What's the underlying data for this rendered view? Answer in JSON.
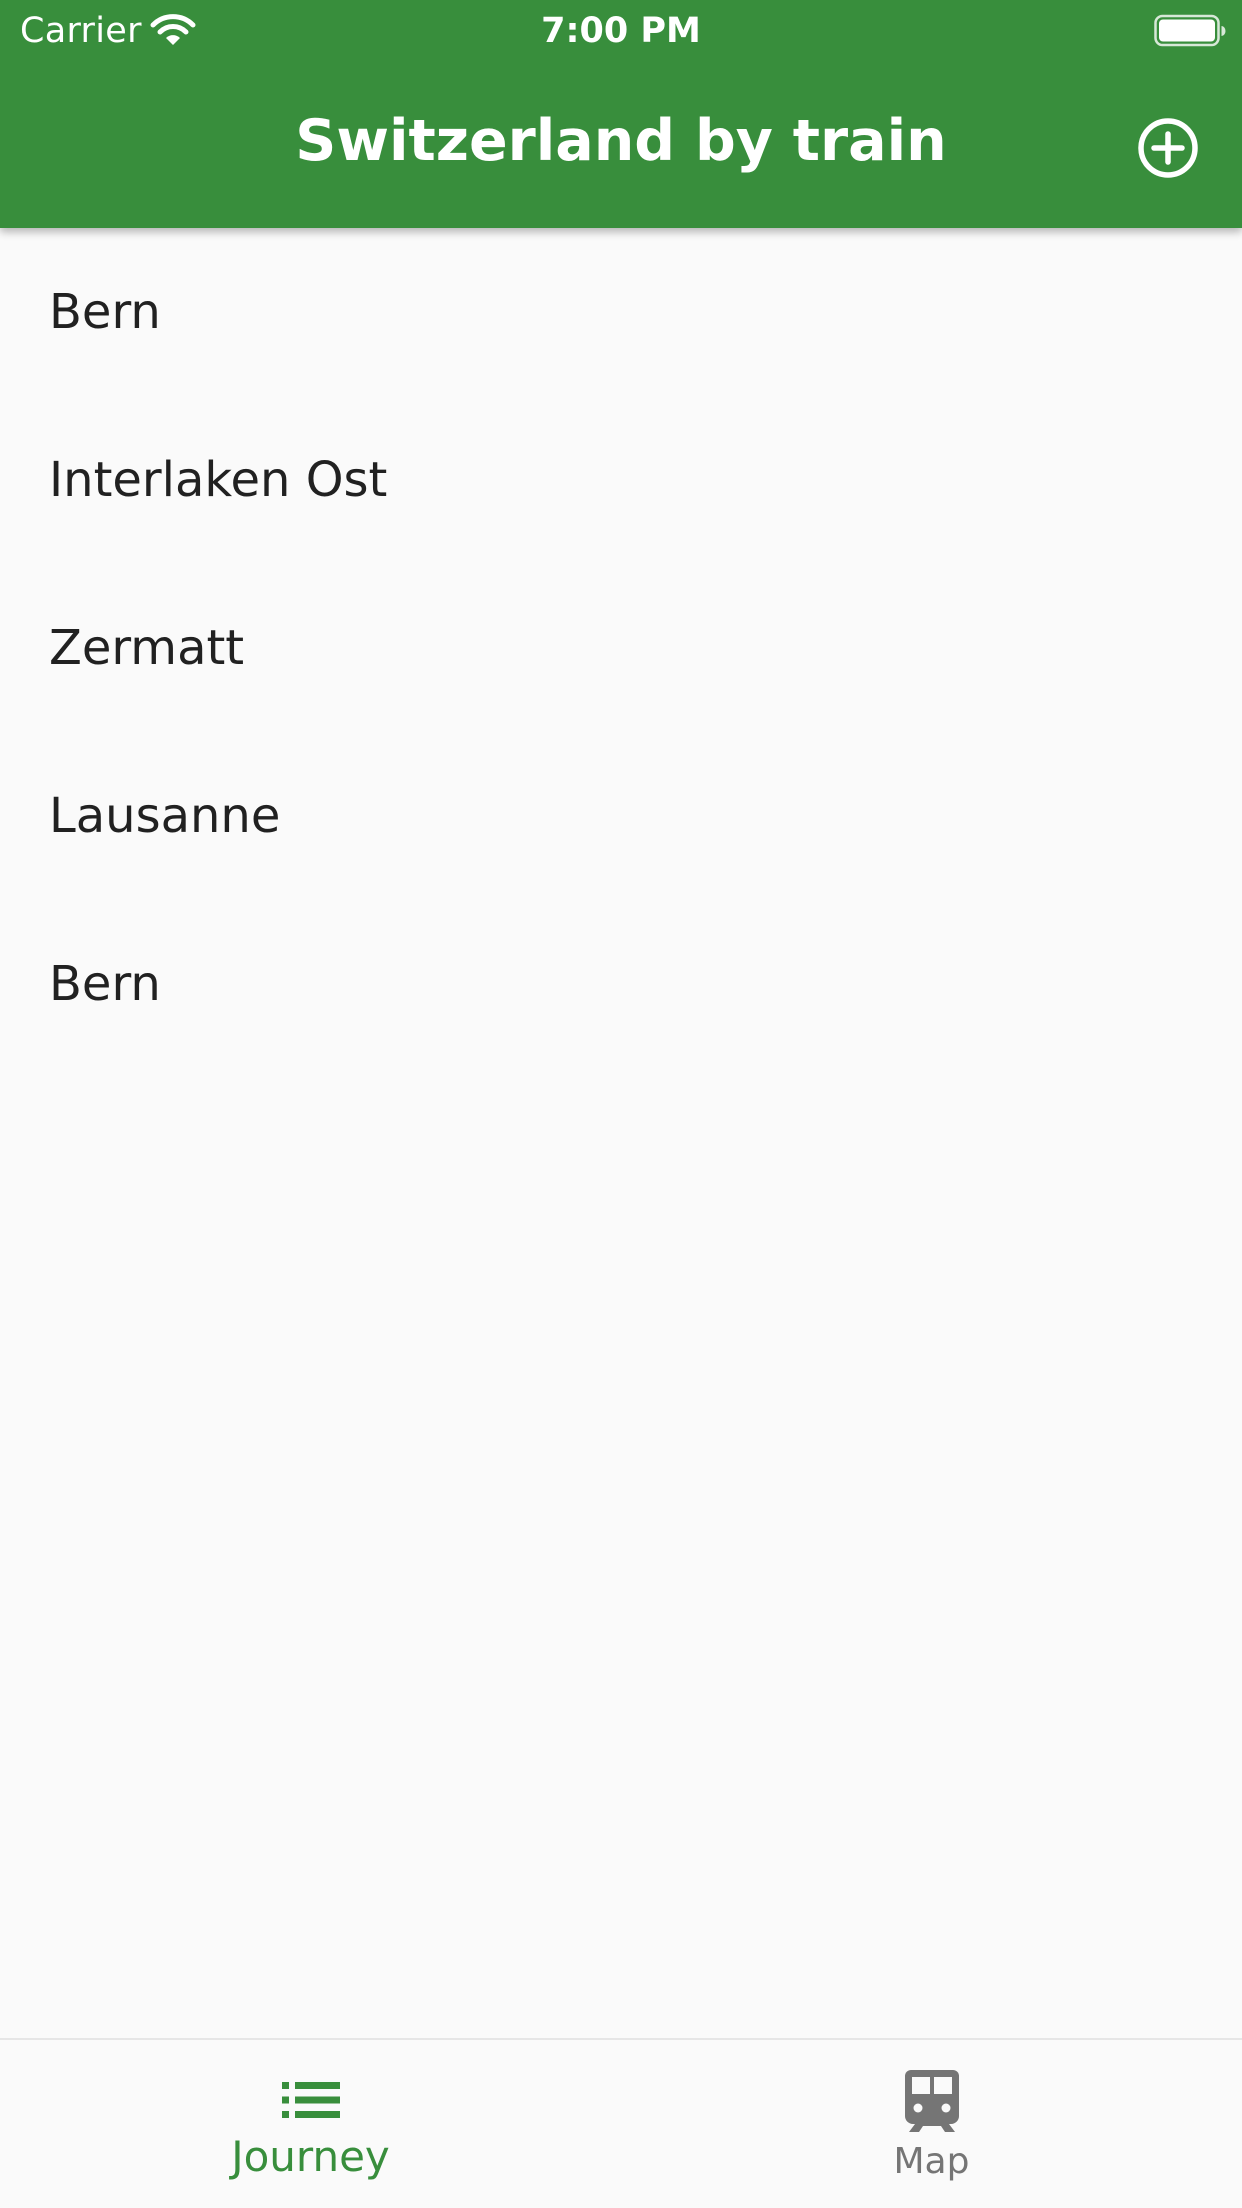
{
  "status_bar": {
    "carrier": "Carrier",
    "time": "7:00 PM",
    "wifi_icon": "wifi-icon",
    "battery_icon": "battery-icon"
  },
  "app_bar": {
    "title": "Switzerland by train",
    "action_icon": "add-circle-icon",
    "background_color": "#388e3c"
  },
  "journey": {
    "stops": [
      "Bern",
      "Interlaken Ost",
      "Zermatt",
      "Lausanne",
      "Bern"
    ]
  },
  "bottom_nav": {
    "selected": "Journey",
    "active_color": "#388e3c",
    "inactive_color": "#757575",
    "items": [
      {
        "label": "Journey",
        "icon": "list-icon"
      },
      {
        "label": "Map",
        "icon": "train-icon"
      }
    ]
  }
}
